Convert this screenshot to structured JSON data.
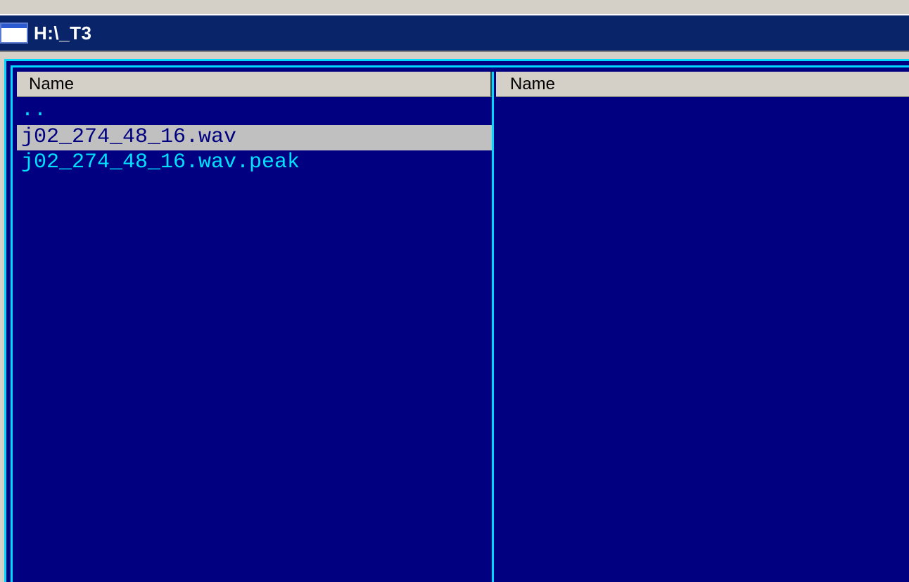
{
  "window": {
    "title": "H:\\_T3"
  },
  "left_panel": {
    "column_header": "Name",
    "items": [
      {
        "name": "..",
        "selected": false
      },
      {
        "name": "j02_274_48_16.wav",
        "selected": true
      },
      {
        "name": "j02_274_48_16.wav.peak",
        "selected": false
      }
    ]
  },
  "right_panel": {
    "column_header": "Name",
    "items": []
  },
  "colors": {
    "panel_background": "#000080",
    "panel_border": "#00d8ff",
    "file_text": "#00e0ff",
    "selection_background": "#c0c0c0",
    "title_bar": "#0a246a"
  }
}
